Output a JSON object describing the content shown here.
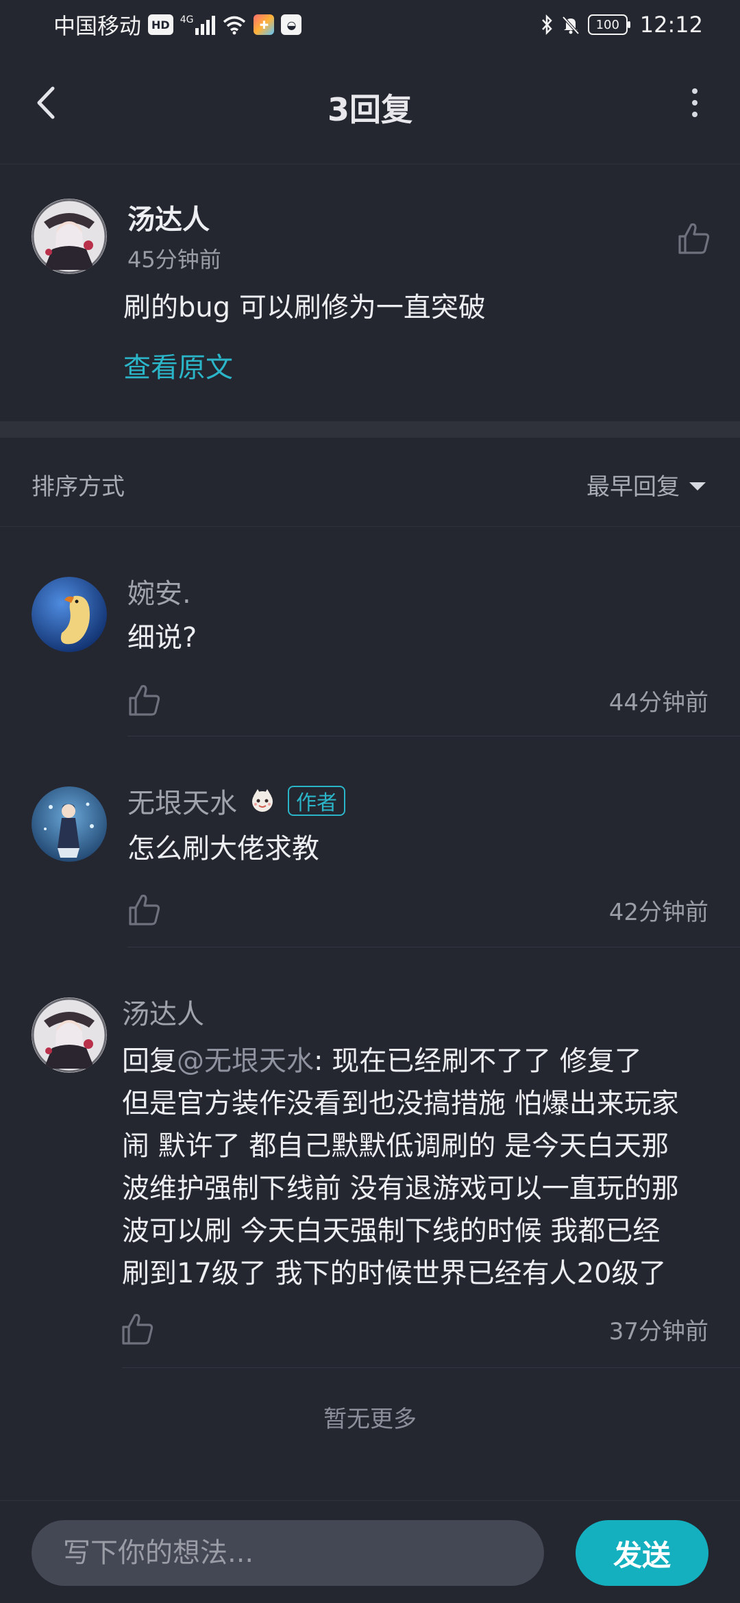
{
  "status_bar": {
    "carrier": "中国移动",
    "hd_label": "HD",
    "network_label": "4G",
    "battery": "100",
    "time": "12:12"
  },
  "header": {
    "title": "3回复"
  },
  "original": {
    "username": "汤达人",
    "time": "45分钟前",
    "text": "刷的bug 可以刷修为一直突破",
    "view_original": "查看原文"
  },
  "sort": {
    "label": "排序方式",
    "selected": "最早回复"
  },
  "replies": [
    {
      "username": "婉安.",
      "text": "细说?",
      "time": "44分钟前"
    },
    {
      "username": "无垠天水",
      "badge": "作者",
      "text": "怎么刷大佬求教",
      "time": "42分钟前"
    },
    {
      "username": "汤达人",
      "reply_prefix": "回复",
      "mention": "@无垠天水",
      "colon": ":",
      "lines": [
        "现在已经刷不了了 修复了",
        "但是官方装作没看到也没搞措施 怕爆出来玩家",
        "闹 默许了 都自己默默低调刷的 是今天白天那",
        "波维护强制下线前 没有退游戏可以一直玩的那",
        "波可以刷 今天白天强制下线的时候 我都已经",
        "刷到17级了 我下的时候世界已经有人20级了"
      ],
      "time": "37分钟前"
    }
  ],
  "footer": {
    "no_more": "暂无更多"
  },
  "input": {
    "placeholder": "写下你的想法...",
    "send_label": "发送"
  },
  "colors": {
    "background": "#252730",
    "accent": "#14b0c0",
    "link": "#2bb5c8"
  }
}
